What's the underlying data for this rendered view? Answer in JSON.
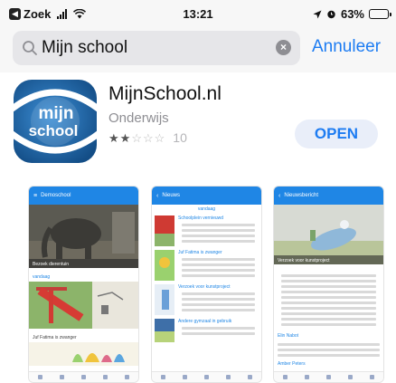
{
  "status_bar": {
    "back_label": "Zoek",
    "time": "13:21",
    "battery": "63%",
    "battery_level": 0.63
  },
  "search": {
    "query": "Mijn school",
    "cancel_label": "Annuleer"
  },
  "app": {
    "name": "MijnSchool.nl",
    "category": "Onderwijs",
    "rating_stars": 2,
    "rating_max": 5,
    "rating_count": "10",
    "open_label": "OPEN",
    "icon_text_top": "mijn",
    "icon_text_bottom": "school",
    "colors": {
      "accent": "#1d7cf2",
      "icon_bg": "#1a6fb8",
      "nav_blue": "#1f86e5"
    }
  },
  "screenshots": [
    {
      "nav_title": "Demoschool",
      "caption_bottom": "Bezoek dierentuin",
      "section_label": "vandaag",
      "item_title": "Juf Fatima is zwanger"
    },
    {
      "nav_title": "Nieuws",
      "caption_top": "vandaag",
      "items": [
        "Schoolplein vernieuwd",
        "Juf Fatima is zwanger",
        "Verzoek voor kunstproject",
        "Andere gymzaal in gebruik"
      ]
    },
    {
      "nav_title": "Nieuwsbericht",
      "caption": "Verzoek voor kunstproject",
      "author_1": "Elin Nabot",
      "author_2": "Amber Peters"
    }
  ]
}
